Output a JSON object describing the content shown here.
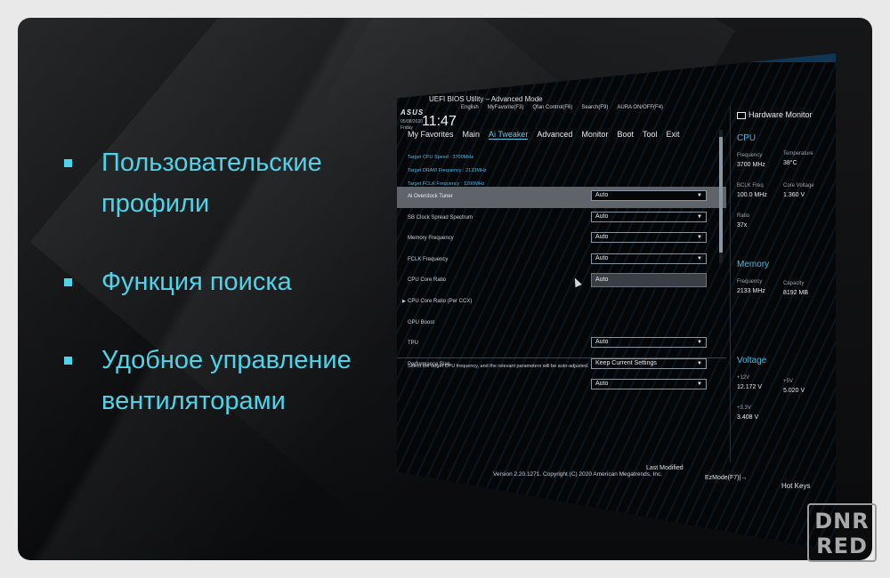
{
  "features": [
    {
      "text": "Пользовательские\nпрофили"
    },
    {
      "text": "Функция поиска"
    },
    {
      "text": "Удобное управление\nвентиляторами"
    }
  ],
  "bios": {
    "logo": "ASUS",
    "title": "UEFI BIOS Utility – Advanced Mode",
    "date": "05/08/2020",
    "day": "Friday",
    "time": "11:47",
    "toolbar": [
      "English",
      "MyFavorite(F3)",
      "Qfan Control(F6)",
      "Search(F9)",
      "AURA ON/OFF(F4)"
    ],
    "tabs": [
      "My Favorites",
      "Main",
      "Ai Tweaker",
      "Advanced",
      "Monitor",
      "Boot",
      "Tool",
      "Exit"
    ],
    "active_tab": "Ai Tweaker",
    "targets": [
      "Target CPU Speed : 3700MHz",
      "Target DRAM Frequency : 2133MHz",
      "Target FCLK Frequency : 1200MHz"
    ],
    "settings": [
      {
        "label": "Ai Overclock Tuner",
        "value": "Auto"
      },
      {
        "label": "SB Clock Spread Spectrum",
        "value": "Auto"
      },
      {
        "label": "Memory Frequency",
        "value": "Auto"
      },
      {
        "label": "FCLK Frequency",
        "value": "Auto"
      },
      {
        "label": "CPU Core Ratio",
        "value": ""
      },
      {
        "label": "CPU Core Ratio (Per CCX)",
        "value": ""
      },
      {
        "label": "GPU Boost",
        "value": ""
      },
      {
        "label": "TPU",
        "value": "Auto"
      },
      {
        "label": "Performance Bias",
        "value": "Keep Current Settings"
      },
      {
        "label": "",
        "value": "Auto"
      }
    ],
    "popup_value": "Auto",
    "description": "Select the target CPU frequency, and the relevant parameters will be auto-adjusted.",
    "copyright": "Version 2.20.1271. Copyright (C) 2020 American Megatrends, Inc.",
    "last_modified": "Last Modified",
    "ezmode": "EzMode(F7)|→",
    "hotkeys": "Hot Keys",
    "hw": {
      "title": "Hardware Monitor",
      "cpu": "CPU",
      "frequency_label": "Frequency",
      "frequency": "3700 MHz",
      "temperature_label": "Temperature",
      "temperature": "38°C",
      "bclk_label": "BCLK Freq",
      "bclk": "100.0 MHz",
      "core_voltage_label": "Core Voltage",
      "core_voltage": "1.360 V",
      "ratio_label": "Ratio",
      "ratio": "37x",
      "memory": "Memory",
      "mem_freq_label": "Frequency",
      "mem_freq": "2133 MHz",
      "capacity_label": "Capacity",
      "capacity": "8192 MB",
      "voltage": "Voltage",
      "v12_label": "+12V",
      "v12": "12.172 V",
      "v5_label": "+5V",
      "v5": "5.020 V",
      "v33_label": "+3.3V",
      "v33": "3.408 V"
    }
  },
  "watermark": {
    "line1": "DNR",
    "line2": "RED"
  }
}
